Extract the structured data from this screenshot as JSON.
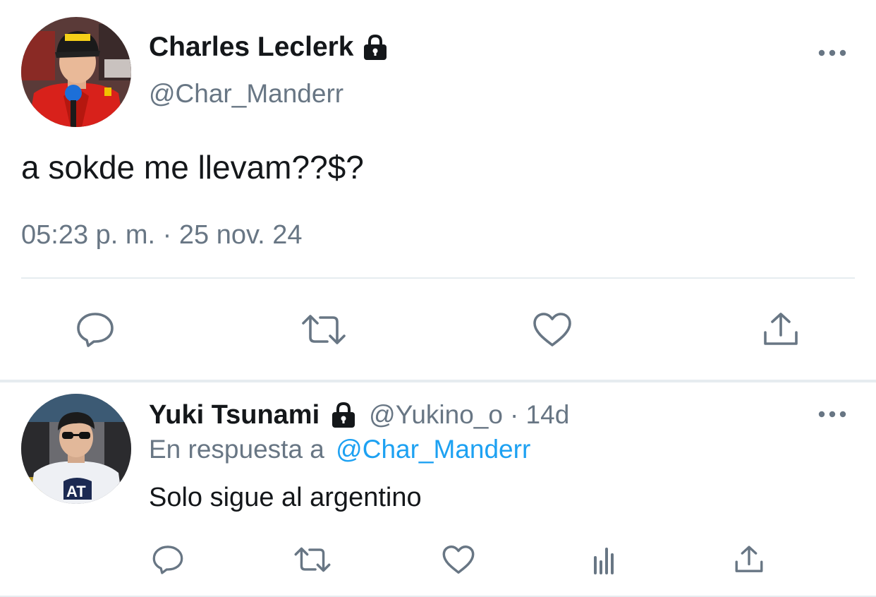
{
  "main_tweet": {
    "author": {
      "name": "Charles Leclerk",
      "handle": "@Char_Manderr",
      "protected_icon": "lock-icon",
      "avatar_icon": "driver-avatar"
    },
    "text": "a sokde me llevam??$?",
    "timestamp": "05:23 p. m. · 25 nov. 24",
    "more_icon": "ellipsis-icon",
    "actions": [
      "reply-icon",
      "retweet-icon",
      "like-icon",
      "share-icon"
    ]
  },
  "reply_tweet": {
    "author": {
      "name": "Yuki Tsunami",
      "handle": "@Yukino_o",
      "time_ago": "· 14d",
      "protected_icon": "lock-icon"
    },
    "in_reply_prefix": "En respuesta a",
    "in_reply_handle": "@Char_Manderr",
    "text": "Solo sigue al argentino",
    "more_icon": "ellipsis-icon",
    "actions": [
      "reply-icon",
      "retweet-icon",
      "like-icon",
      "analytics-icon",
      "share-icon"
    ]
  },
  "colors": {
    "text": "#14171a",
    "secondary": "#687684",
    "link": "#1da1f2",
    "divider": "#e6ecf0"
  }
}
